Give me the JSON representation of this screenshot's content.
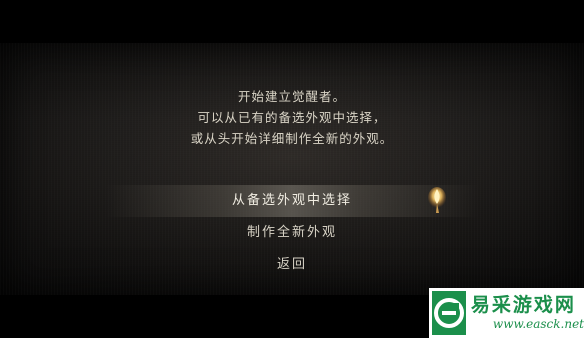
{
  "intro": {
    "lines": [
      "开始建立觉醒者。",
      "可以从已有的备选外观中选择，",
      "或从头开始详细制作全新的外观。"
    ]
  },
  "menu": {
    "items": [
      {
        "label": "从备选外观中选择",
        "selected": true
      },
      {
        "label": "制作全新外观",
        "selected": false
      },
      {
        "label": "返回",
        "selected": false
      }
    ]
  },
  "cursor_icon": "candle-flame-icon",
  "watermark": {
    "name": "易采游戏网",
    "url": "www.easck.net",
    "color": "#1b8f4b"
  }
}
